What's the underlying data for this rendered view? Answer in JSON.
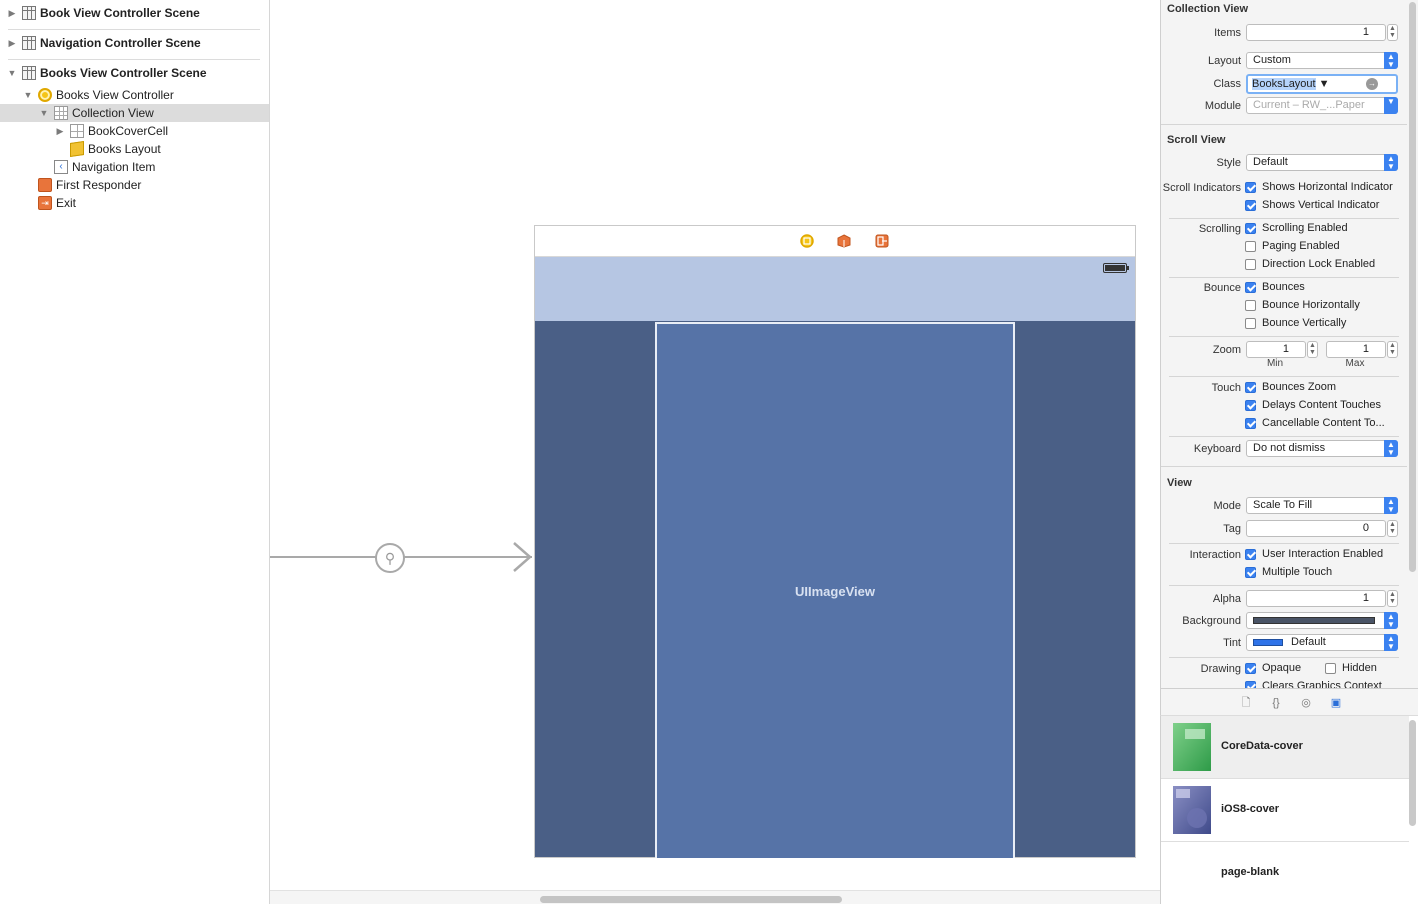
{
  "outline": {
    "scenes": [
      {
        "label": "Book View Controller Scene",
        "expanded": false
      },
      {
        "label": "Navigation Controller Scene",
        "expanded": false
      },
      {
        "label": "Books View Controller Scene",
        "expanded": true
      }
    ],
    "tree": [
      {
        "label": "Books View Controller",
        "icon": "view-controller-icon"
      },
      {
        "label": "Collection View",
        "icon": "collection-view-icon",
        "selected": true
      },
      {
        "label": "BookCoverCell",
        "icon": "collection-cell-icon"
      },
      {
        "label": "Books Layout",
        "icon": "layout-object-icon"
      },
      {
        "label": "Navigation Item",
        "icon": "navigation-item-icon"
      },
      {
        "label": "First Responder",
        "icon": "first-responder-icon"
      },
      {
        "label": "Exit",
        "icon": "exit-icon"
      }
    ]
  },
  "canvas": {
    "image_view_label": "UIImageView",
    "colors": {
      "navbar": "#b6c6e3",
      "collection_bg": "#4a5f86",
      "cell": "#5673a7"
    }
  },
  "inspector": {
    "collection_view": {
      "title": "Collection View",
      "items_label": "Items",
      "items_value": "1",
      "layout_label": "Layout",
      "layout_value": "Custom",
      "class_label": "Class",
      "class_value": "BooksLayout",
      "module_label": "Module",
      "module_value": "Current – RW_...Paper"
    },
    "scroll_view": {
      "title": "Scroll View",
      "style_label": "Style",
      "style_value": "Default",
      "indicators_label": "Scroll Indicators",
      "shows_horizontal": "Shows Horizontal Indicator",
      "shows_vertical": "Shows Vertical Indicator",
      "scrolling_label": "Scrolling",
      "scrolling_enabled": "Scrolling Enabled",
      "paging_enabled": "Paging Enabled",
      "direction_lock": "Direction Lock Enabled",
      "bounce_label": "Bounce",
      "bounces": "Bounces",
      "bounce_horizontally": "Bounce Horizontally",
      "bounce_vertically": "Bounce Vertically",
      "zoom_label": "Zoom",
      "zoom_min": "1",
      "zoom_max": "1",
      "min_label": "Min",
      "max_label": "Max",
      "touch_label": "Touch",
      "bounces_zoom": "Bounces Zoom",
      "delays_content": "Delays Content Touches",
      "cancellable_content": "Cancellable Content To...",
      "keyboard_label": "Keyboard",
      "keyboard_value": "Do not dismiss"
    },
    "view": {
      "title": "View",
      "mode_label": "Mode",
      "mode_value": "Scale To Fill",
      "tag_label": "Tag",
      "tag_value": "0",
      "interaction_label": "Interaction",
      "user_interaction": "User Interaction Enabled",
      "multiple_touch": "Multiple Touch",
      "alpha_label": "Alpha",
      "alpha_value": "1",
      "background_label": "Background",
      "tint_label": "Tint",
      "tint_value": "Default",
      "drawing_label": "Drawing",
      "opaque": "Opaque",
      "hidden": "Hidden",
      "clears_graphics": "Clears Graphics Context"
    }
  },
  "library": {
    "tabs": [
      "file-template-icon",
      "code-snippet-icon",
      "object-icon",
      "media-icon"
    ],
    "items": [
      {
        "name": "CoreData-cover",
        "selected": true
      },
      {
        "name": "iOS8-cover",
        "selected": false
      },
      {
        "name": "page-blank",
        "selected": false
      }
    ]
  }
}
